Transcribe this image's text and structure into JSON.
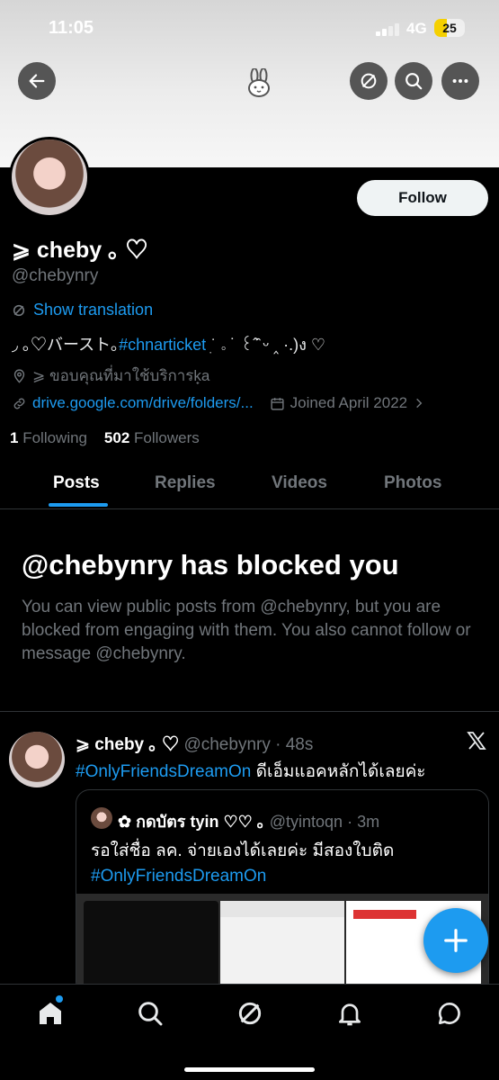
{
  "status_bar": {
    "time": "11:05",
    "network": "4G",
    "battery": "25"
  },
  "header": {
    "back_icon": "arrow-left-icon",
    "logo_icon": "bunny-icon",
    "grok_icon": "grok-icon",
    "search_icon": "search-icon",
    "more_icon": "more-icon"
  },
  "profile": {
    "follow_label": "Follow",
    "display_name": "⩾ cheby ｡ ♡",
    "handle": "@chebynry",
    "show_translation": "Show translation",
    "bio_prefix": "  ◞  ｡♡バースト｡",
    "bio_tag": "#chnarticket",
    "bio_suffix": " ׅ ͘ ｡  ˙ ꒰ˆ̑ ᵕ ‸ ·.)ง ♡",
    "location": "⩾ ขอบคุณที่มาใช้บริการk̟a",
    "link": "drive.google.com/drive/folders/...",
    "joined": "Joined April 2022",
    "following_count": "1",
    "following_label": "Following",
    "followers_count": "502",
    "followers_label": "Followers"
  },
  "tabs": [
    {
      "label": "Posts",
      "active": true
    },
    {
      "label": "Replies",
      "active": false
    },
    {
      "label": "Videos",
      "active": false
    },
    {
      "label": "Photos",
      "active": false
    }
  ],
  "blocked": {
    "title": "@chebynry has blocked you",
    "text": "You can view public posts from @chebynry, but you are blocked from engaging with them. You also cannot follow or message @chebynry."
  },
  "tweet": {
    "name": "⩾ cheby ｡ ♡",
    "handle_time": "@chebynry · 48s",
    "tag": "#OnlyFriendsDreamOn",
    "text": " ดีเอ็มแอคหลักได้เลยค่ะ",
    "quote": {
      "name": "✿ กดบัตร tyin ♡♡ ｡",
      "handle_time": "@tyintoqn · 3m",
      "text": "รอใส่ชื่อ ลค. จ่ายเองได้เลยค่ะ มีสองใบติด",
      "tag": "#OnlyFriendsDreamOn"
    }
  },
  "colors": {
    "accent": "#1d9bf0",
    "background": "#000000",
    "muted": "#71767b"
  }
}
